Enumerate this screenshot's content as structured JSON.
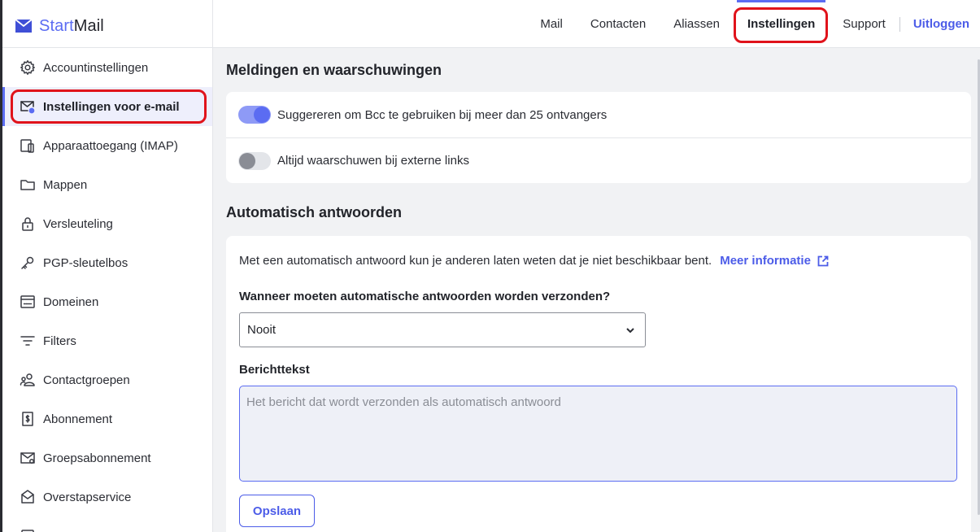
{
  "app": {
    "logo_start": "Start",
    "logo_mail": "Mail"
  },
  "topnav": {
    "items": [
      {
        "label": "Mail"
      },
      {
        "label": "Contacten"
      },
      {
        "label": "Aliassen"
      },
      {
        "label": "Instellingen",
        "active": true
      },
      {
        "label": "Support"
      }
    ],
    "logout": "Uitloggen"
  },
  "sidebar": {
    "items": [
      {
        "label": "Accountinstellingen",
        "icon": "gear-icon"
      },
      {
        "label": "Instellingen voor e-mail",
        "icon": "mail-settings-icon",
        "active": true
      },
      {
        "label": "Apparaattoegang (IMAP)",
        "icon": "devices-icon"
      },
      {
        "label": "Mappen",
        "icon": "folder-icon"
      },
      {
        "label": "Versleuteling",
        "icon": "lock-icon"
      },
      {
        "label": "PGP-sleutelbos",
        "icon": "key-icon"
      },
      {
        "label": "Domeinen",
        "icon": "domain-icon"
      },
      {
        "label": "Filters",
        "icon": "filter-icon"
      },
      {
        "label": "Contactgroepen",
        "icon": "contact-groups-icon"
      },
      {
        "label": "Abonnement",
        "icon": "subscription-icon"
      },
      {
        "label": "Groepsabonnement",
        "icon": "group-subscription-icon"
      },
      {
        "label": "Overstapservice",
        "icon": "transfer-icon"
      },
      {
        "label": "",
        "icon": "more-icon"
      }
    ]
  },
  "notifications": {
    "title": "Meldingen en waarschuwingen",
    "toggles": [
      {
        "label": "Suggereren om Bcc te gebruiken bij meer dan 25 ontvangers",
        "on": true
      },
      {
        "label": "Altijd waarschuwen bij externe links",
        "on": false
      }
    ]
  },
  "autoreply": {
    "title": "Automatisch antwoorden",
    "intro": "Met een automatisch antwoord kun je anderen laten weten dat je niet beschikbaar bent.",
    "more_info": "Meer informatie",
    "when_label": "Wanneer moeten automatische antwoorden worden verzonden?",
    "when_value": "Nooit",
    "body_label": "Berichttekst",
    "body_placeholder": "Het bericht dat wordt verzonden als automatisch antwoord",
    "body_value": "",
    "save_label": "Opslaan"
  },
  "colors": {
    "accent": "#5b6cf2",
    "link": "#4c5ce8",
    "highlight": "#e0131b"
  }
}
